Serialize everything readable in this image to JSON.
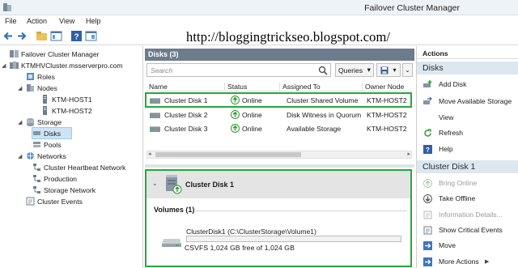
{
  "window": {
    "title": "Failover Cluster Manager"
  },
  "menu": [
    {
      "label": "File"
    },
    {
      "label": "Action"
    },
    {
      "label": "View"
    },
    {
      "label": "Help"
    }
  ],
  "watermark": "http://bloggingtrickseo.blogspot.com/",
  "tree": [
    {
      "label": "Failover Cluster Manager",
      "icon": "failover-manager-icon"
    },
    {
      "label": "KTMHVCluster.msserverpro.com",
      "icon": "cluster-icon"
    },
    {
      "label": "Roles",
      "icon": "roles-icon"
    },
    {
      "label": "Nodes",
      "icon": "nodes-icon"
    },
    {
      "label": "KTM-HOST1",
      "icon": "server-icon"
    },
    {
      "label": "KTM-HOST2",
      "icon": "server-icon"
    },
    {
      "label": "Storage",
      "icon": "storage-icon"
    },
    {
      "label": "Disks",
      "icon": "disks-icon",
      "selected": true
    },
    {
      "label": "Pools",
      "icon": "pools-icon"
    },
    {
      "label": "Networks",
      "icon": "networks-icon"
    },
    {
      "label": "Cluster Heartbeat Network",
      "icon": "network-icon"
    },
    {
      "label": "Production",
      "icon": "network-icon"
    },
    {
      "label": "Storage Network",
      "icon": "network-icon"
    },
    {
      "label": "Cluster Events",
      "icon": "events-icon"
    }
  ],
  "disks": {
    "header": "Disks (3)",
    "search_placeholder": "Search",
    "queries_label": "Queries",
    "columns": [
      "Name",
      "Status",
      "Assigned To",
      "Owner Node"
    ],
    "rows": [
      {
        "name": "Cluster Disk 1",
        "status": "Online",
        "assigned": "Cluster Shared Volume",
        "owner": "KTM-HOST2"
      },
      {
        "name": "Cluster Disk 2",
        "status": "Online",
        "assigned": "Disk Witness in Quorum",
        "owner": "KTM-HOST2"
      },
      {
        "name": "Cluster Disk 3",
        "status": "Online",
        "assigned": "Available Storage",
        "owner": "KTM-HOST2"
      }
    ]
  },
  "detail": {
    "title": "Cluster Disk 1",
    "volumes_title": "Volumes (1)",
    "volume": {
      "name": "ClusterDisk1 (C:\\ClusterStorage\\Volume1)",
      "info": "CSVFS 1,024 GB free of 1,024 GB",
      "used_fraction": 0.0
    }
  },
  "actions": {
    "header": "Actions",
    "sections": [
      {
        "title": "Disks",
        "items": [
          {
            "label": "Add Disk",
            "icon": "add-disk-icon",
            "enabled": true
          },
          {
            "label": "Move Available Storage",
            "icon": "move-storage-icon",
            "enabled": true
          },
          {
            "label": "View",
            "icon": "",
            "enabled": true
          },
          {
            "label": "Refresh",
            "icon": "refresh-icon",
            "enabled": true
          },
          {
            "label": "Help",
            "icon": "help-icon",
            "enabled": true
          }
        ]
      },
      {
        "title": "Cluster Disk 1",
        "items": [
          {
            "label": "Bring Online",
            "icon": "bring-online-icon",
            "enabled": false
          },
          {
            "label": "Take Offline",
            "icon": "take-offline-icon",
            "enabled": true
          },
          {
            "label": "Information Details...",
            "icon": "information-icon",
            "enabled": false
          },
          {
            "label": "Show Critical Events",
            "icon": "critical-events-icon",
            "enabled": true
          },
          {
            "label": "Move",
            "icon": "move-icon",
            "enabled": true
          },
          {
            "label": "More Actions",
            "icon": "more-actions-icon",
            "enabled": true
          }
        ]
      }
    ]
  },
  "colors": {
    "highlight_box": "#23a83b",
    "header_band": "#6d7c8d",
    "selection": "#cde4f7",
    "online": "#2e9a2e"
  }
}
